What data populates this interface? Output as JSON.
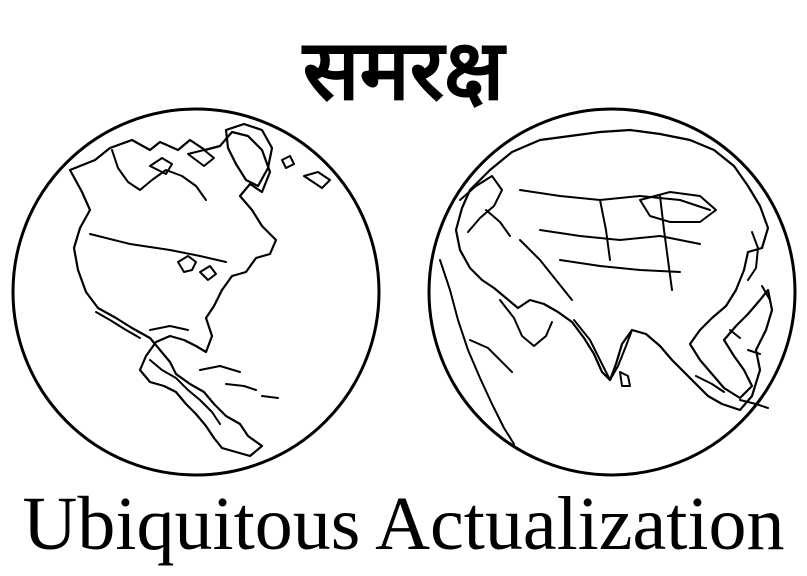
{
  "logo": {
    "title": "समरक्ष",
    "tagline": "Ubiquitous Actualization"
  },
  "globes": [
    {
      "icon": "western-hemisphere-globe-icon"
    },
    {
      "icon": "eastern-hemisphere-globe-icon"
    }
  ],
  "colors": {
    "ink": "#000000",
    "background": "#ffffff"
  }
}
